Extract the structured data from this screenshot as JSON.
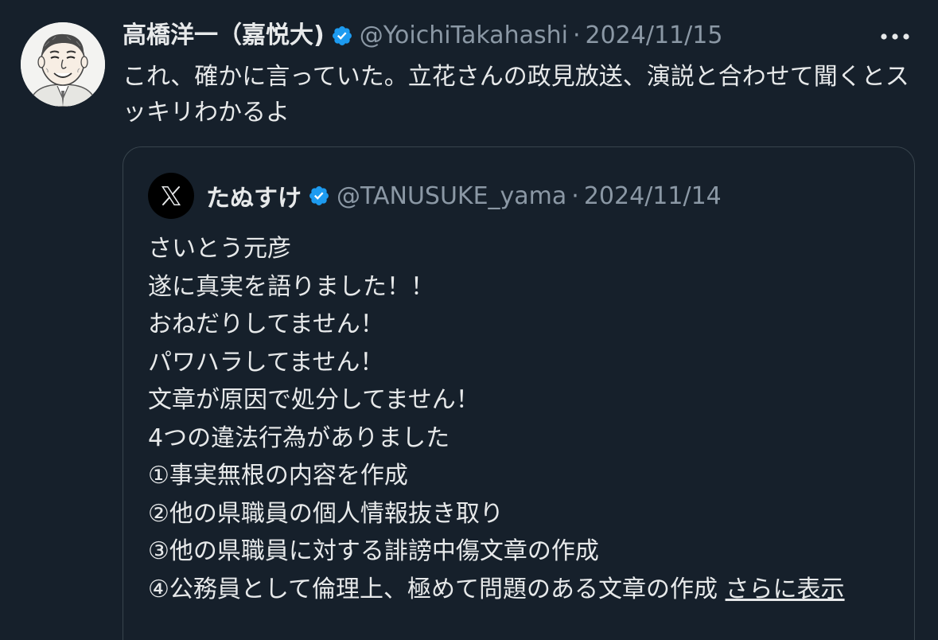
{
  "tweet": {
    "author_name": "高橋洋一（嘉悦大)",
    "handle": "@YoichiTakahashi",
    "separator": "·",
    "date": "2024/11/15",
    "text": "これ、確かに言っていた。立花さんの政見放送、演説と合わせて聞くとスッキリわかるよ"
  },
  "quoted": {
    "author_name": "たぬすけ",
    "handle": "@TANUSUKE_yama",
    "separator": "·",
    "date": "2024/11/14",
    "lines": [
      "さいとう元彦",
      "遂に真実を語りました！！",
      "おねだりしてません！",
      "パワハラしてません！",
      "文章が原因で処分してません！",
      "4つの違法行為がありました",
      "①事実無根の内容を作成",
      "②他の県職員の個人情報抜き取り",
      "③他の県職員に対する誹謗中傷文章の作成",
      "④公務員として倫理上、極めて問題のある文章の作成"
    ],
    "show_more": "さらに表示"
  },
  "icons": {
    "verified": "verified-badge-icon",
    "more": "more-dots-icon",
    "x_logo": "x-logo-icon"
  },
  "colors": {
    "background": "#16202b",
    "text": "#e7e9ea",
    "secondary": "#8b98a5",
    "verified": "#1d9bf0",
    "border": "#38444d"
  }
}
